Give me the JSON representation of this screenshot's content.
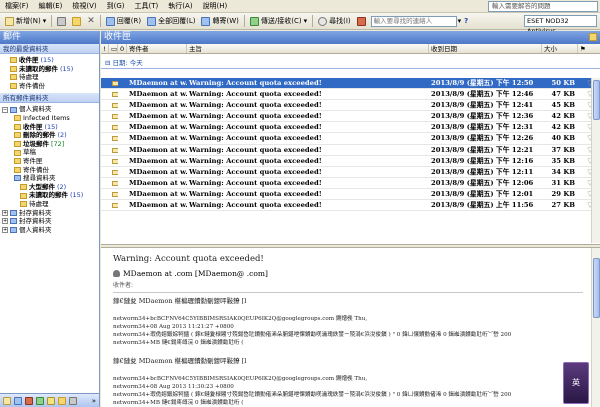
{
  "menu": [
    "檔案(F)",
    "編輯(E)",
    "檢視(V)",
    "到(G)",
    "工具(T)",
    "執行(A)",
    "說明(H)"
  ],
  "help_search_placeholder": "輸入需要解答的問題",
  "toolbar": {
    "new_label": "新增(N)",
    "reply_label": "回覆(R)",
    "reply_all_label": "全部回覆(L)",
    "forward_label": "轉寄(W)",
    "send_receive_label": "傳送/接收(C)",
    "find_label": "尋找(I)",
    "contact_search_placeholder": "輸入要尋找的連絡人",
    "eset_label": "ESET NOD32 Antivirus"
  },
  "mail_pane_title": "郵件",
  "favorites_title": "我的最愛資料夾",
  "favorites": [
    {
      "name": "收件匣",
      "count": "(15)",
      "bold": true
    },
    {
      "name": "未讀取的郵件",
      "count": "(15)",
      "bold": true
    },
    {
      "name": "待處理",
      "count": "",
      "bold": false
    },
    {
      "name": "寄件備份",
      "count": "",
      "bold": false
    }
  ],
  "all_folders_title": "所有郵件資料夾",
  "personal_folders": "個人資料夾",
  "folders": [
    {
      "name": "Infected Items",
      "count": "",
      "bold": false,
      "indent": 2
    },
    {
      "name": "收件匣",
      "count": "(15)",
      "bold": true,
      "indent": 2
    },
    {
      "name": "刪除的郵件",
      "count": "(2)",
      "bold": true,
      "indent": 2
    },
    {
      "name": "垃圾郵件",
      "count": "[72]",
      "bold": true,
      "indent": 2
    },
    {
      "name": "草稿",
      "count": "",
      "bold": false,
      "indent": 2
    },
    {
      "name": "寄件匣",
      "count": "",
      "bold": false,
      "indent": 2
    },
    {
      "name": "寄件備份",
      "count": "",
      "bold": false,
      "indent": 2
    },
    {
      "name": "搜尋資料夾",
      "count": "",
      "bold": false,
      "indent": 2
    },
    {
      "name": "大型郵件",
      "count": "(2)",
      "bold": true,
      "indent": 3
    },
    {
      "name": "未讀取的郵件",
      "count": "(15)",
      "bold": true,
      "indent": 3
    },
    {
      "name": "待處理",
      "count": "",
      "bold": false,
      "indent": 3
    }
  ],
  "archive_folders": [
    "封存資料夾",
    "封存資料夾",
    "個人資料夾"
  ],
  "inbox_title": "收件匣",
  "columns": {
    "importance": "!",
    "icon": "",
    "attach": "0",
    "from": "寄件者",
    "subject": "主旨",
    "received": "收到日期",
    "size": "大小"
  },
  "group_label": "日期: 今天",
  "emails": [
    {
      "from": "MDaemon at w...",
      "subject": "Warning: Account quota exceeded!",
      "date": "2013/8/9 (星期五) 下午 12:50",
      "size": "50 KB",
      "selected": true
    },
    {
      "from": "MDaemon at w...",
      "subject": "Warning: Account quota exceeded!",
      "date": "2013/8/9 (星期五) 下午 12:46",
      "size": "47 KB",
      "selected": false
    },
    {
      "from": "MDaemon at w...",
      "subject": "Warning: Account quota exceeded!",
      "date": "2013/8/9 (星期五) 下午 12:41",
      "size": "45 KB",
      "selected": false
    },
    {
      "from": "MDaemon at w...",
      "subject": "Warning: Account quota exceeded!",
      "date": "2013/8/9 (星期五) 下午 12:36",
      "size": "42 KB",
      "selected": false
    },
    {
      "from": "MDaemon at w...",
      "subject": "Warning: Account quota exceeded!",
      "date": "2013/8/9 (星期五) 下午 12:31",
      "size": "42 KB",
      "selected": false
    },
    {
      "from": "MDaemon at w...",
      "subject": "Warning: Account quota exceeded!",
      "date": "2013/8/9 (星期五) 下午 12:26",
      "size": "40 KB",
      "selected": false
    },
    {
      "from": "MDaemon at w...",
      "subject": "Warning: Account quota exceeded!",
      "date": "2013/8/9 (星期五) 下午 12:21",
      "size": "37 KB",
      "selected": false
    },
    {
      "from": "MDaemon at w...",
      "subject": "Warning: Account quota exceeded!",
      "date": "2013/8/9 (星期五) 下午 12:16",
      "size": "35 KB",
      "selected": false
    },
    {
      "from": "MDaemon at w...",
      "subject": "Warning: Account quota exceeded!",
      "date": "2013/8/9 (星期五) 下午 12:11",
      "size": "34 KB",
      "selected": false
    },
    {
      "from": "MDaemon at w...",
      "subject": "Warning: Account quota exceeded!",
      "date": "2013/8/9 (星期五) 下午 12:06",
      "size": "31 KB",
      "selected": false
    },
    {
      "from": "MDaemon at w...",
      "subject": "Warning: Account quota exceeded!",
      "date": "2013/8/9 (星期五) 下午 12:01",
      "size": "29 KB",
      "selected": false
    },
    {
      "from": "MDaemon at w...",
      "subject": "Warning: Account quota exceeded!",
      "date": "2013/8/9 (星期五) 上午 11:56",
      "size": "27 KB",
      "selected": false
    }
  ],
  "preview": {
    "subject": "Warning: Account quota exceeded!",
    "from": "MDaemon at                .com [MDaemon@                .com]",
    "to": "收件者:",
    "lines": [
      {
        "text": "鎵€鏈夋 MDaemon 椹楄瓑鐨勬劅鍐呯敤鐐  [l",
        "big": true,
        "gap": false
      },
      {
        "text": "networm34+bcBCFNV64C5YIBBIMSRSIAK0QEUP6IK2Q@googlegroups.com 鍘熷彂 Thu,",
        "big": false,
        "gap": true
      },
      {
        "text": "networm34+08 Aug 2013 11:21:27 +0800",
        "big": false,
        "gap": false
      },
      {
        "text": "networm34+瑕佹嫆鍛婃牱鍤 ( 鎵€鏈夐椂闂寸殑鍚嶅瓧鐨勯偖浠朵腑鍖呭惈鐨勫唴瀹瑰紩鐢ㄧ殑涓€浜涗俊鎭 ) \" 0 鍏ㄩ儴鐨勯偖浠 0 鍓嶉潰鐨勫瓧绗﹀嵆 200",
        "big": false,
        "gap": false
      },
      {
        "text": "networm34+MB 鏈€鍚庝竴浣 0 鍓嶉潰鐨勫瓧绗  (",
        "big": false,
        "gap": false
      },
      {
        "text": "鎵€鏈夋 MDaemon 椹楄瓑鐨勬劅鍐呯敤鐐  [l",
        "big": true,
        "gap": true
      },
      {
        "text": "networm34+bcBCFNV64C5YIBBIMSRSIAK0QEUP6IK2Q@googlegroups.com 鍘熷彂 Thu,",
        "big": false,
        "gap": true
      },
      {
        "text": "networm34+08 Aug 2013 11:30:23 +0800",
        "big": false,
        "gap": false
      },
      {
        "text": "networm34+瑕佹嫆鍛婃牱鍤 ( 鎵€鏈夐椂闂寸殑鍚嶅瓧鐨勯偖浠朵腑鍖呭惈鐨勫唴瀹瑰紩鐢ㄧ殑涓€浜涗俊鎭 ) \" 0 鍏ㄩ儴鐨勯偖浠 0 鍓嶉潰鐨勫瓧绗﹀嵆 200",
        "big": false,
        "gap": false
      },
      {
        "text": "networm34+MB 鏈€鍚庝竴浣 0 鍓嶉潰鐨勫瓧绗  (",
        "big": false,
        "gap": false
      }
    ]
  },
  "widget_label": "英",
  "colors": {
    "header_blue": "#4d78c8",
    "selection": "#316ac5",
    "count_blue": "#1e3fb3",
    "count_green": "#0b7d25"
  }
}
